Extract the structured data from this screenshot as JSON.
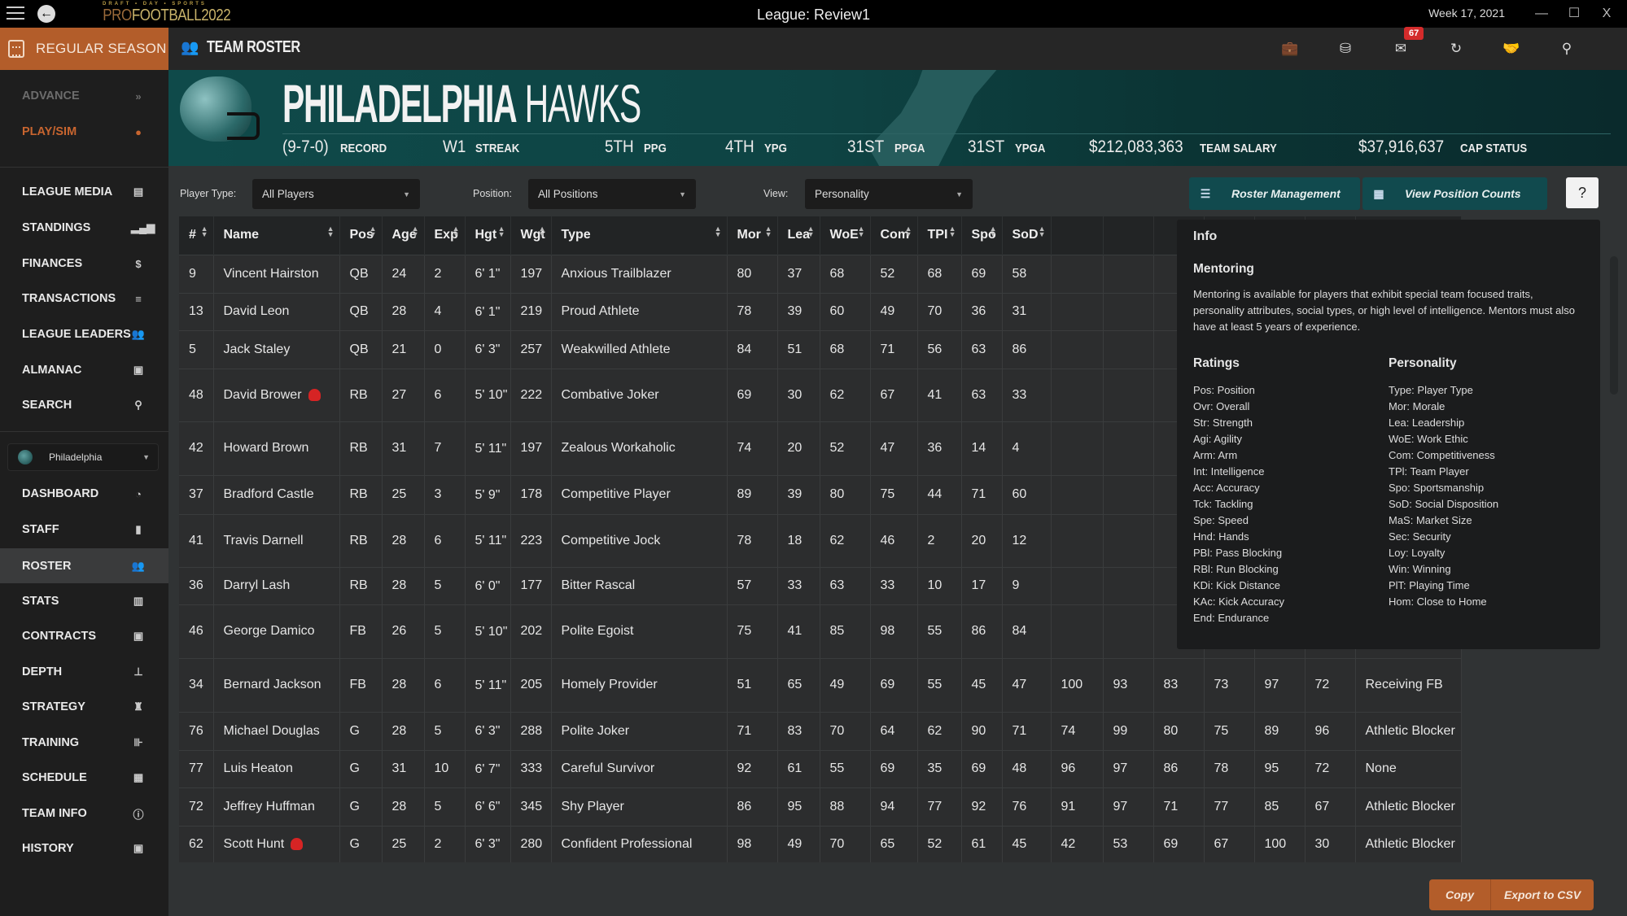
{
  "window": {
    "title": "League: Review1",
    "date": "Week 17, 2021",
    "logo_tagline": "DRAFT • DAY • SPORTS",
    "logo_pro": "PRO",
    "logo_rest": "FOOTBALL2022",
    "controls": [
      "—",
      "☐",
      "X"
    ]
  },
  "topbar": {
    "season_label": "REGULAR SEASON",
    "page_title": "TEAM ROSTER",
    "mail_badge": "67",
    "icons": [
      "briefcase-icon",
      "database-icon",
      "mail-icon",
      "refresh-icon",
      "handshake-icon",
      "binoculars-icon"
    ]
  },
  "sidebar": {
    "top_items": [
      {
        "label": "ADVANCE",
        "icon": "»"
      },
      {
        "label": "PLAY/SIM",
        "icon": "🏈"
      }
    ],
    "league_items": [
      {
        "label": "LEAGUE MEDIA",
        "icon": "▭"
      },
      {
        "label": "STANDINGS",
        "icon": "▁▃▅▇"
      },
      {
        "label": "FINANCES",
        "icon": "$"
      },
      {
        "label": "TRANSACTIONS",
        "icon": "⇌"
      },
      {
        "label": "LEAGUE LEADERS",
        "icon": "👥"
      },
      {
        "label": "ALMANAC",
        "icon": "▤"
      },
      {
        "label": "SEARCH",
        "icon": "🔍"
      }
    ],
    "team_selector": "Philadelphia",
    "team_items": [
      {
        "label": "DASHBOARD",
        "icon": "◔"
      },
      {
        "label": "STAFF",
        "icon": "▮"
      },
      {
        "label": "ROSTER",
        "icon": "👥",
        "active": true
      },
      {
        "label": "STATS",
        "icon": "▥"
      },
      {
        "label": "CONTRACTS",
        "icon": "▣"
      },
      {
        "label": "DEPTH",
        "icon": "⊥"
      },
      {
        "label": "STRATEGY",
        "icon": "♜"
      },
      {
        "label": "TRAINING",
        "icon": "⊪"
      },
      {
        "label": "SCHEDULE",
        "icon": "▦"
      },
      {
        "label": "TEAM INFO",
        "icon": "ⓘ"
      },
      {
        "label": "HISTORY",
        "icon": "▤"
      }
    ]
  },
  "banner": {
    "city": "PHILADELPHIA",
    "nickname": "HAWKS",
    "stats": [
      {
        "value": "(9-7-0)",
        "label": "RECORD"
      },
      {
        "value": "W1",
        "label": "STREAK"
      },
      {
        "value": "5TH",
        "label": "PPG"
      },
      {
        "value": "4TH",
        "label": "YPG"
      },
      {
        "value": "31ST",
        "label": "PPGA"
      },
      {
        "value": "31ST",
        "label": "YPGA"
      },
      {
        "value": "$212,083,363",
        "label": "TEAM SALARY"
      },
      {
        "value": "$37,916,637",
        "label": "CAP STATUS"
      }
    ]
  },
  "filters": {
    "player_type_label": "Player Type:",
    "player_type_value": "All Players",
    "position_label": "Position:",
    "position_value": "All Positions",
    "view_label": "View:",
    "view_value": "Personality",
    "roster_management": "Roster Management",
    "view_position_counts": "View Position Counts",
    "help": "?"
  },
  "table": {
    "columns": [
      "#",
      "Name",
      "Pos",
      "Age",
      "Exp",
      "Hgt",
      "Wgt",
      "Type",
      "Mor",
      "Lea",
      "WoE",
      "Com",
      "TPI",
      "Spo",
      "SoD",
      "",
      "",
      "",
      "",
      "",
      "",
      ""
    ],
    "rows": [
      {
        "num": "9",
        "name": "Vincent Hairston",
        "injured": false,
        "pos": "QB",
        "age": "24",
        "exp": "2",
        "hgt": "6' 1\"",
        "wgt": "197",
        "type": "Anxious Trailblazer",
        "vals": [
          "80",
          "37",
          "68",
          "52",
          "68",
          "69",
          "58"
        ],
        "extra": []
      },
      {
        "num": "13",
        "name": "David Leon",
        "injured": false,
        "pos": "QB",
        "age": "28",
        "exp": "4",
        "hgt": "6' 1\"",
        "wgt": "219",
        "type": "Proud Athlete",
        "vals": [
          "78",
          "39",
          "60",
          "49",
          "70",
          "36",
          "31"
        ],
        "extra": []
      },
      {
        "num": "5",
        "name": "Jack Staley",
        "injured": false,
        "pos": "QB",
        "age": "21",
        "exp": "0",
        "hgt": "6' 3\"",
        "wgt": "257",
        "type": "Weakwilled Athlete",
        "vals": [
          "84",
          "51",
          "68",
          "71",
          "56",
          "63",
          "86"
        ],
        "extra": []
      },
      {
        "num": "48",
        "name": "David Brower",
        "injured": true,
        "pos": "RB",
        "age": "27",
        "exp": "6",
        "hgt": "5' 10\"",
        "wgt": "222",
        "type": "Combative Joker",
        "vals": [
          "69",
          "30",
          "62",
          "67",
          "41",
          "63",
          "33"
        ],
        "extra": []
      },
      {
        "num": "42",
        "name": "Howard Brown",
        "injured": false,
        "pos": "RB",
        "age": "31",
        "exp": "7",
        "hgt": "5' 11\"",
        "wgt": "197",
        "type": "Zealous Workaholic",
        "vals": [
          "74",
          "20",
          "52",
          "47",
          "36",
          "14",
          "4"
        ],
        "extra": []
      },
      {
        "num": "37",
        "name": "Bradford Castle",
        "injured": false,
        "pos": "RB",
        "age": "25",
        "exp": "3",
        "hgt": "5' 9\"",
        "wgt": "178",
        "type": "Competitive Player",
        "vals": [
          "89",
          "39",
          "80",
          "75",
          "44",
          "71",
          "60"
        ],
        "extra": []
      },
      {
        "num": "41",
        "name": "Travis Darnell",
        "injured": false,
        "pos": "RB",
        "age": "28",
        "exp": "6",
        "hgt": "5' 11\"",
        "wgt": "223",
        "type": "Competitive Jock",
        "vals": [
          "78",
          "18",
          "62",
          "46",
          "2",
          "20",
          "12"
        ],
        "extra": []
      },
      {
        "num": "36",
        "name": "Darryl Lash",
        "injured": false,
        "pos": "RB",
        "age": "28",
        "exp": "5",
        "hgt": "6' 0\"",
        "wgt": "177",
        "type": "Bitter Rascal",
        "vals": [
          "57",
          "33",
          "63",
          "33",
          "10",
          "17",
          "9"
        ],
        "extra": []
      },
      {
        "num": "46",
        "name": "George Damico",
        "injured": false,
        "pos": "FB",
        "age": "26",
        "exp": "5",
        "hgt": "5' 10\"",
        "wgt": "202",
        "type": "Polite Egoist",
        "vals": [
          "75",
          "41",
          "85",
          "98",
          "55",
          "86",
          "84"
        ],
        "extra": []
      },
      {
        "num": "34",
        "name": "Bernard Jackson",
        "injured": false,
        "pos": "FB",
        "age": "28",
        "exp": "6",
        "hgt": "5' 11\"",
        "wgt": "205",
        "type": "Homely Provider",
        "vals": [
          "51",
          "65",
          "49",
          "69",
          "55",
          "45",
          "47"
        ],
        "extra": [
          "100",
          "93",
          "83",
          "73",
          "97",
          "72",
          "Receiving FB"
        ]
      },
      {
        "num": "76",
        "name": "Michael Douglas",
        "injured": false,
        "pos": "G",
        "age": "28",
        "exp": "5",
        "hgt": "6' 3\"",
        "wgt": "288",
        "type": "Polite Joker",
        "vals": [
          "71",
          "83",
          "70",
          "64",
          "62",
          "90",
          "71"
        ],
        "extra": [
          "74",
          "99",
          "80",
          "75",
          "89",
          "96",
          "Athletic Blocker"
        ]
      },
      {
        "num": "77",
        "name": "Luis Heaton",
        "injured": false,
        "pos": "G",
        "age": "31",
        "exp": "10",
        "hgt": "6' 7\"",
        "wgt": "333",
        "type": "Careful Survivor",
        "vals": [
          "92",
          "61",
          "55",
          "69",
          "35",
          "69",
          "48"
        ],
        "extra": [
          "96",
          "97",
          "86",
          "78",
          "95",
          "72",
          "None"
        ]
      },
      {
        "num": "72",
        "name": "Jeffrey Huffman",
        "injured": false,
        "pos": "G",
        "age": "28",
        "exp": "5",
        "hgt": "6' 6\"",
        "wgt": "345",
        "type": "Shy Player",
        "vals": [
          "86",
          "95",
          "88",
          "94",
          "77",
          "92",
          "76"
        ],
        "extra": [
          "91",
          "97",
          "71",
          "77",
          "85",
          "67",
          "Athletic Blocker"
        ]
      },
      {
        "num": "62",
        "name": "Scott Hunt",
        "injured": true,
        "pos": "G",
        "age": "25",
        "exp": "2",
        "hgt": "6' 3\"",
        "wgt": "280",
        "type": "Confident Professional",
        "vals": [
          "98",
          "49",
          "70",
          "65",
          "52",
          "61",
          "45"
        ],
        "extra": [
          "42",
          "53",
          "69",
          "67",
          "100",
          "30",
          "Athletic Blocker"
        ]
      }
    ]
  },
  "info_panel": {
    "title": "Info",
    "mentoring_title": "Mentoring",
    "mentoring_text": "Mentoring is available for players that exhibit special team focused traits, personality attributes, social types, or high level of intelligence. Mentors must also have at least 5 years of experience.",
    "ratings_title": "Ratings",
    "ratings": [
      "Pos: Position",
      "Ovr: Overall",
      "Str: Strength",
      "Agi: Agility",
      "Arm: Arm",
      "Int: Intelligence",
      "Acc: Accuracy",
      "Tck: Tackling",
      "Spe: Speed",
      "Hnd: Hands",
      "PBl: Pass Blocking",
      "RBl: Run Blocking",
      "KDi: Kick Distance",
      "KAc: Kick Accuracy",
      "End: Endurance"
    ],
    "personality_title": "Personality",
    "personality": [
      "Type: Player Type",
      "Mor: Morale",
      "Lea: Leadership",
      "WoE: Work Ethic",
      "Com: Competitiveness",
      "TPl: Team Player",
      "Spo: Sportsmanship",
      "SoD: Social Disposition",
      "MaS: Market Size",
      "Sec: Security",
      "Loy: Loyalty",
      "Win: Winning",
      "PlT: Playing Time",
      "Hom: Close to Home"
    ]
  },
  "footer": {
    "copy": "Copy",
    "export": "Export to CSV"
  }
}
